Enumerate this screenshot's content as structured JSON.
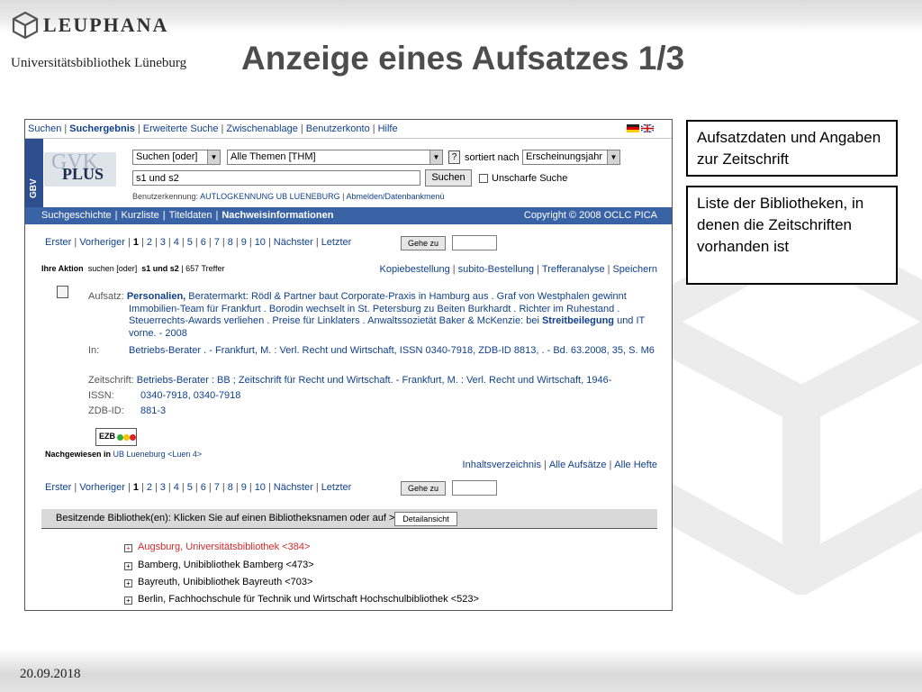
{
  "slide": {
    "logo_text": "LEUPHANA",
    "logo_subtitle": "Universitätsbibliothek Lüneburg",
    "title": "Anzeige eines Aufsatzes 1/3",
    "date": "20.09.2018",
    "callouts": [
      "Aufsatzdaten und Angaben zur Zeitschrift",
      "Liste der Bibliotheken, in denen die Zeitschriften vorhanden ist"
    ]
  },
  "screenshot": {
    "top_nav": [
      "Suchen",
      "Suchergebnis",
      "Erweiterte Suche",
      "Zwischenablage",
      "Benutzerkonto",
      "Hilfe"
    ],
    "side_label": "GBV",
    "brand": {
      "big": "GVK",
      "plus": "PLUS"
    },
    "search_mode": "Suchen [oder]",
    "search_theme": "Alle Themen [THM]",
    "help_glyph": "?",
    "sort_label": "sortiert nach",
    "sort_value": "Erscheinungsjahr",
    "query": "s1 und s2",
    "search_button": "Suchen",
    "fuzzy_label": "Unscharfe Suche",
    "user": {
      "label": "Benutzerkennung:",
      "account": "AUTLOGKENNUNG UB LUENEBURG",
      "logout": "Abmelden/Datenbankmenü"
    },
    "blue_tabs": [
      "Suchgeschichte",
      "Kurzliste",
      "Titeldaten",
      "Nachweisinformationen"
    ],
    "copyright": "Copyright © 2008 OCLC PICA",
    "pager": {
      "first": "Erster",
      "prev": "Vorheriger",
      "pages": [
        "1",
        "2",
        "3",
        "4",
        "5",
        "6",
        "7",
        "8",
        "9",
        "10"
      ],
      "next": "Nächster",
      "last": "Letzter",
      "go": "Gehe zu"
    },
    "action": {
      "label": "Ihre Aktion",
      "verb": "suchen [oder]",
      "query": "s1 und s2",
      "hits": "657 Treffer"
    },
    "action_links": [
      "Kopiebestellung",
      "subito-Bestellung",
      "Trefferanalyse",
      "Speichern"
    ],
    "record": {
      "article_label": "Aufsatz:",
      "article_bold": "Personalien,",
      "article_line1": " Beratermarkt: Rödl & Partner baut Corporate-Praxis in Hamburg aus . Graf von Westphalen gewinnt",
      "article_line2": "Immobilien-Team für Frankfurt . Borodin wechselt in St. Petersburg zu Beiten Burkhardt . Richter im Ruhestand .",
      "article_line3a": "Steuerrechts-Awards verliehen . Preise für Linklaters . Anwaltssozietät Baker & McKenzie: bei ",
      "article_line3_bold": "Streitbeilegung",
      "article_line3b": " und IT",
      "article_line4": "vorne. - 2008",
      "in_label": "In:",
      "in_value": "Betriebs-Berater . - Frankfurt, M. : Verl. Recht und Wirtschaft, ISSN 0340-7918, ZDB-ID 8813, . - Bd. 63.2008, 35, S. M6",
      "journal_label": "Zeitschrift:",
      "journal_value": "Betriebs-Berater : BB ; Zeitschrift für Recht und Wirtschaft. - Frankfurt, M. : Verl. Recht und Wirtschaft, 1946-",
      "issn_label": "ISSN:",
      "issn_value": "0340-7918, 0340-7918",
      "zdb_label": "ZDB-ID:",
      "zdb_value": "881-3"
    },
    "ezb_label": "EZB",
    "ezb_colors": {
      "green": "#33aa33",
      "yellow": "#f2c200",
      "red": "#dd2222"
    },
    "proof": {
      "label": "Nachgewiesen in",
      "library": "UB Lueneburg",
      "link": "<Luen 4>"
    },
    "toc_links": [
      "Inhaltsverzeichnis",
      "Alle Aufsätze",
      "Alle Hefte"
    ],
    "libraries_header": "Besitzende Bibliothek(en): Klicken Sie auf einen Bibliotheksnamen oder auf >",
    "detail_button": "Detailansicht",
    "libraries": [
      "Augsburg, Universitätsbibliothek <384>",
      "Bamberg, Unibibliothek Bamberg <473>",
      "Bayreuth, Unibibliothek Bayreuth <703>",
      "Berlin, Fachhochschule für Technik und Wirtschaft Hochschulbibliothek <523>"
    ],
    "highlight_color": "#d42a2a",
    "link_color": "#11408c"
  }
}
